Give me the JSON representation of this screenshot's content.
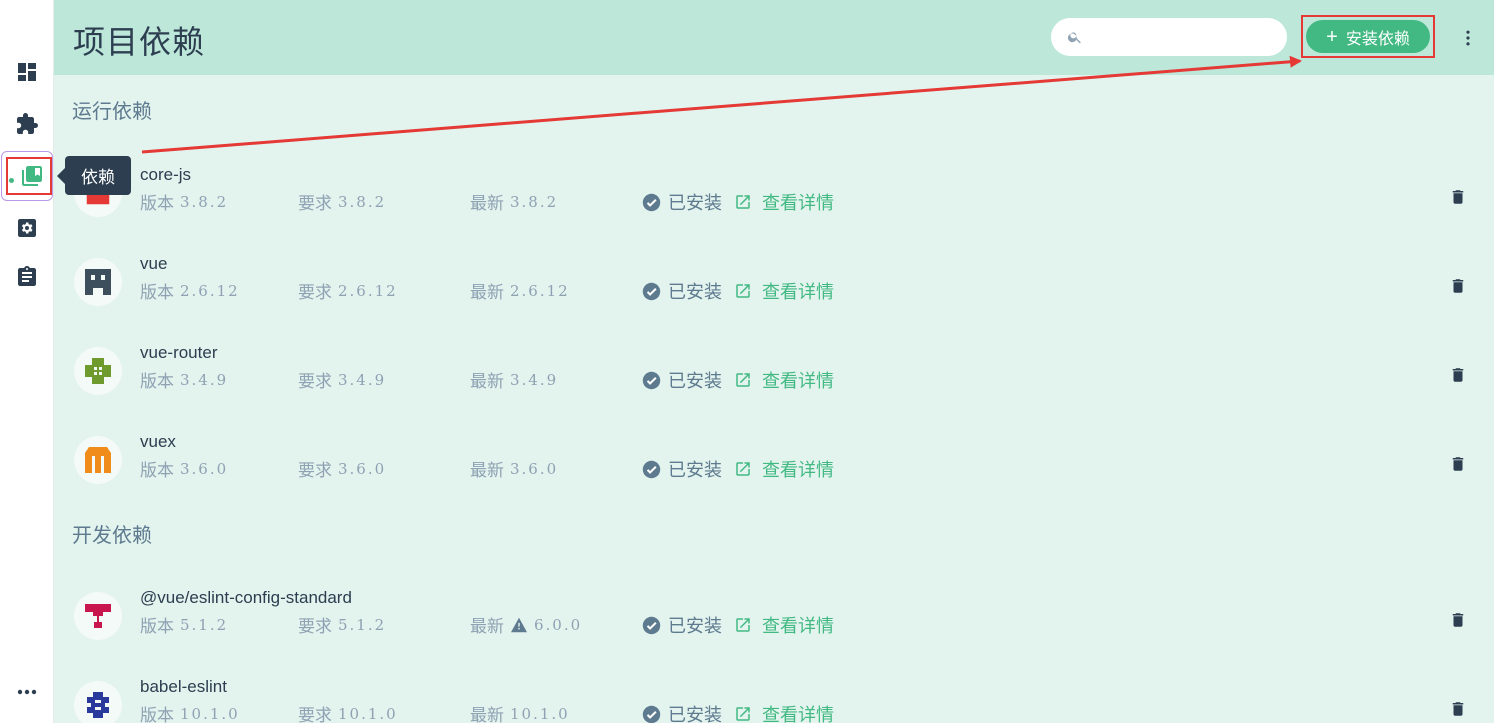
{
  "header": {
    "title": "项目依赖",
    "search_placeholder": "",
    "install_label": "安装依赖"
  },
  "tooltip": {
    "label": "依赖"
  },
  "colors": {
    "accent": "#42b983",
    "header_bg": "#bce7d9",
    "page_bg": "#e3f3ee",
    "annotation": "#e53935"
  },
  "sections": [
    {
      "title": "运行依赖"
    },
    {
      "title": "开发依赖"
    }
  ],
  "labels": {
    "version": "版本",
    "wanted": "要求",
    "latest": "最新",
    "installed": "已安装",
    "details": "查看详情"
  },
  "dependencies": [
    {
      "name": "core-js",
      "version": "3.8.2",
      "wanted": "3.8.2",
      "latest": "3.8.2",
      "logo_color": "#e53935",
      "warning": false
    },
    {
      "name": "vue",
      "version": "2.6.12",
      "wanted": "2.6.12",
      "latest": "2.6.12",
      "logo_color": "#3d4f5c",
      "warning": false
    },
    {
      "name": "vue-router",
      "version": "3.4.9",
      "wanted": "3.4.9",
      "latest": "3.4.9",
      "logo_color": "#6f9a2e",
      "warning": false
    },
    {
      "name": "vuex",
      "version": "3.6.0",
      "wanted": "3.6.0",
      "latest": "3.6.0",
      "logo_color": "#f08c1a",
      "warning": false
    },
    {
      "name": "@vue/eslint-config-standard",
      "version": "5.1.2",
      "wanted": "5.1.2",
      "latest": "6.0.0",
      "logo_color": "#c8174f",
      "warning": true
    },
    {
      "name": "babel-eslint",
      "version": "10.1.0",
      "wanted": "10.1.0",
      "latest": "10.1.0",
      "logo_color": "#2a3a9c",
      "warning": false
    }
  ],
  "sidebar_icons": [
    "dashboard-icon",
    "plugin-icon",
    "dependencies-icon",
    "settings-icon",
    "tasks-icon",
    "more-icon"
  ]
}
